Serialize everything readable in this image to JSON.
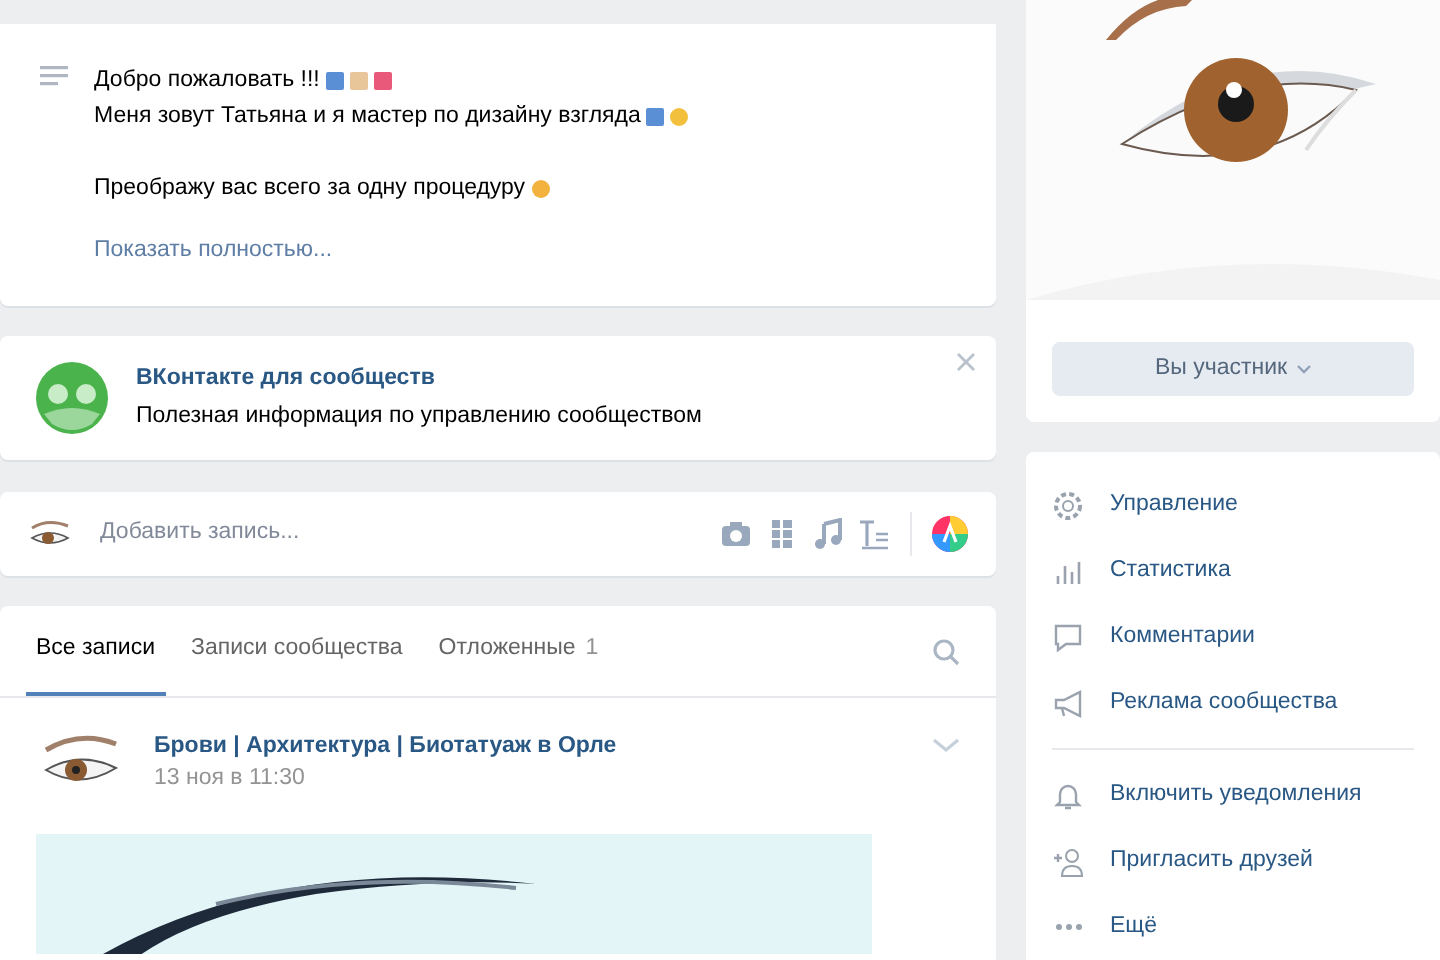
{
  "description": {
    "paragraphs": [
      {
        "lines": [
          "Добро пожаловать !!!",
          "Меня зовут Татьяна и я мастер по дизайну взгляда"
        ]
      },
      {
        "lines": [
          "Преображу вас всего за одну процедуру"
        ]
      }
    ],
    "more_link": "Показать полностью..."
  },
  "promo": {
    "title": "ВКонтакте для сообществ",
    "text": "Полезная информация по управлению сообществом"
  },
  "composer": {
    "placeholder": "Добавить запись..."
  },
  "wall_tabs": [
    {
      "label": "Все записи",
      "selected": true
    },
    {
      "label": "Записи сообщества",
      "selected": false
    },
    {
      "label": "Отложенные",
      "count": "1",
      "selected": false
    }
  ],
  "post": {
    "author": "Брови | Архитектура | Биотатуаж в Орле",
    "time": "13 ноя в 11:30",
    "kind": "picture"
  },
  "membership_button": "Вы участник",
  "menu_groups": [
    [
      {
        "label": "Управление"
      },
      {
        "label": "Статистика"
      },
      {
        "label": "Комментарии"
      },
      {
        "label": "Реклама сообщества"
      }
    ],
    [
      {
        "label": "Включить уведомления"
      },
      {
        "label": "Пригласить друзей"
      },
      {
        "label": "Ещё"
      }
    ]
  ]
}
